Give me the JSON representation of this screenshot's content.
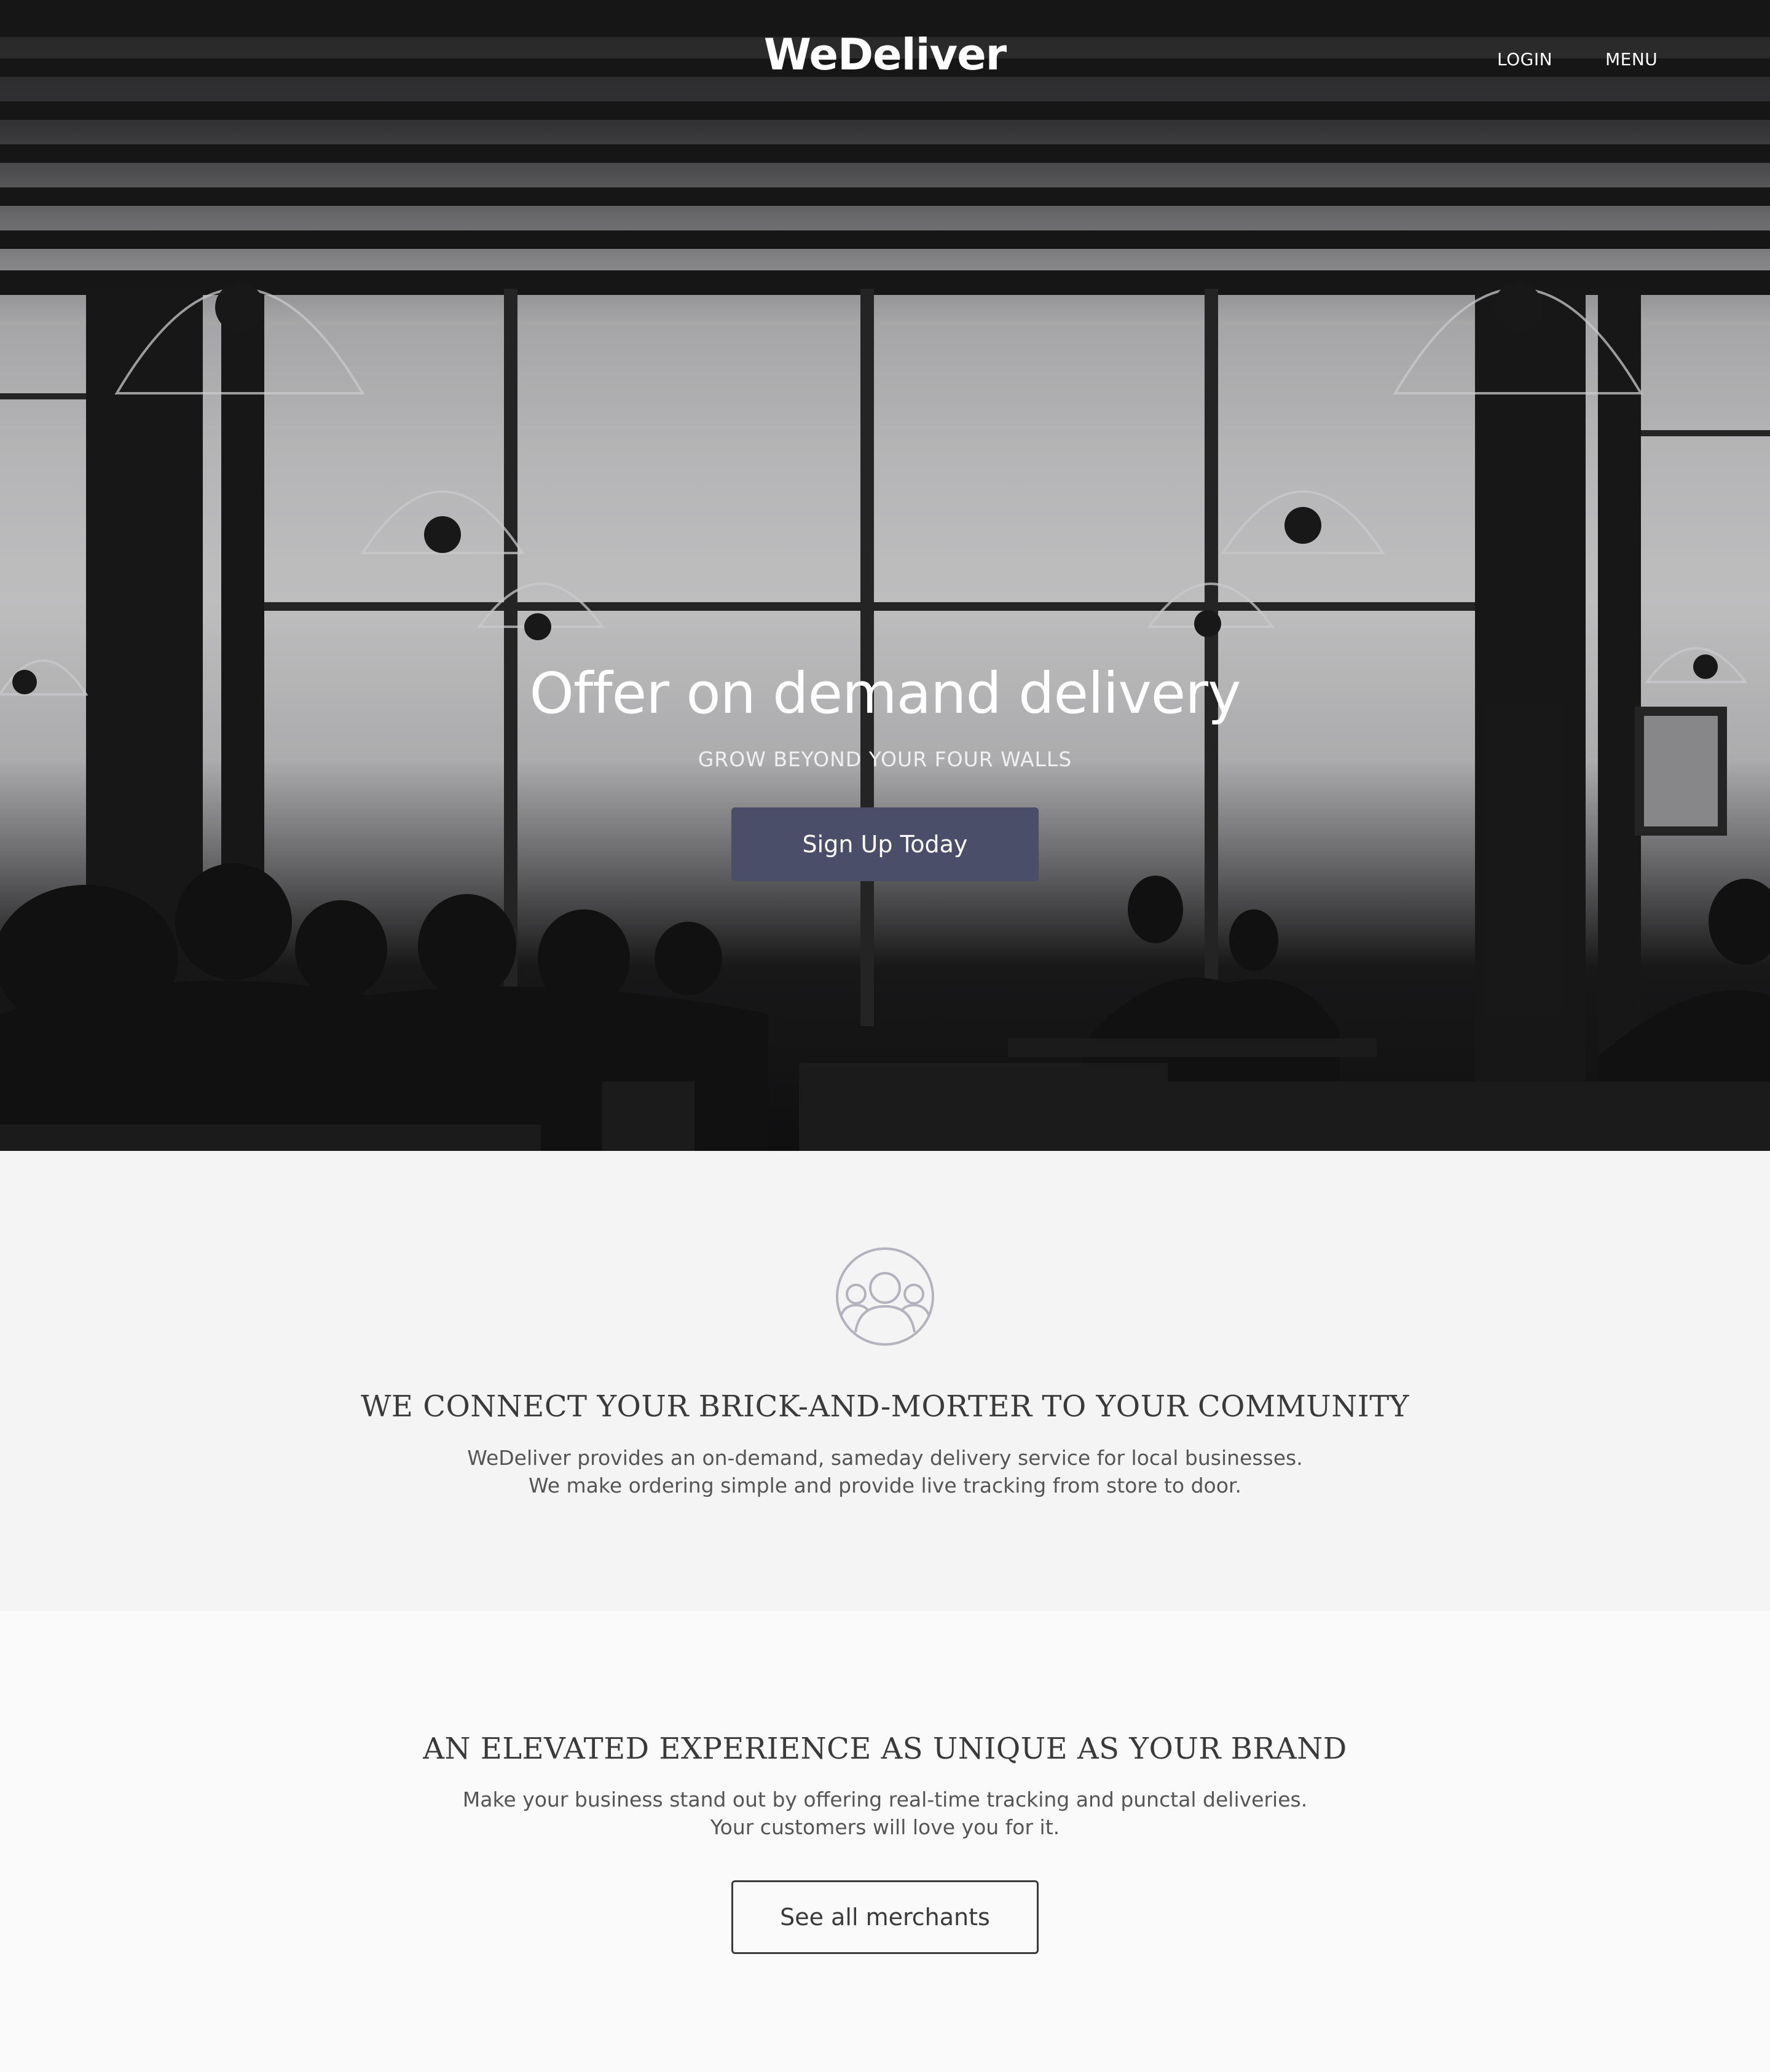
{
  "header": {
    "brand": "WeDeliver",
    "login_label": "LOGIN",
    "menu_label": "MENU"
  },
  "hero": {
    "title": "Offer on demand delivery",
    "subtitle": "GROW BEYOND YOUR FOUR WALLS",
    "cta_label": "Sign Up Today",
    "cta_color": "#4a4e68"
  },
  "community": {
    "icon": "community-group-icon",
    "heading": "WE CONNECT YOUR BRICK-AND-MORTER TO YOUR COMMUNITY",
    "text_line1": "WeDeliver provides an on-demand, sameday delivery service for local businesses.",
    "text_line2": "We make ordering simple and provide live tracking from store to door."
  },
  "experience": {
    "heading": "AN ELEVATED EXPERIENCE AS UNIQUE AS YOUR BRAND",
    "text_line1": "Make your business stand out by offering real-time tracking and punctal deliveries.",
    "text_line2": "Your customers will love you for it.",
    "button_label": "See all merchants"
  }
}
